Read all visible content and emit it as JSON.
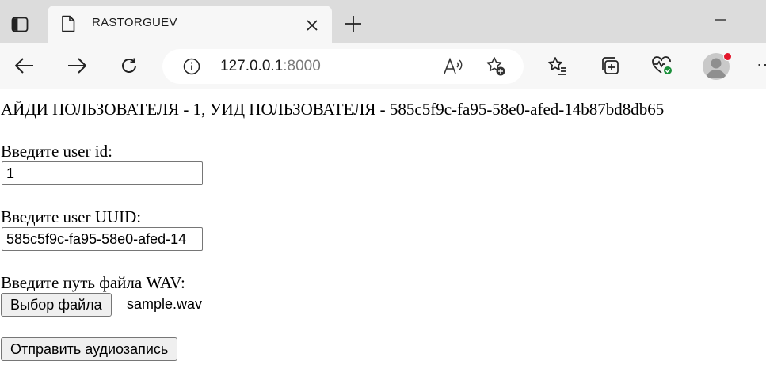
{
  "browser": {
    "tab": {
      "title": "RASTORGUEV"
    },
    "address": {
      "host": "127.0.0.1",
      "port": ":8000"
    }
  },
  "page": {
    "heading": "АЙДИ ПОЛЬЗОВАТЕЛЯ - 1, УИД ПОЛЬЗОВАТЕЛЯ - 585c5f9c-fa95-58e0-afed-14b87bd8db65",
    "user_id": {
      "label": "Введите user id:",
      "value": "1"
    },
    "user_uuid": {
      "label": "Введите user UUID:",
      "value": "585c5f9c-fa95-58e0-afed-14"
    },
    "wav": {
      "label": "Введите путь файла WAV:",
      "button": "Выбор файла",
      "filename": "sample.wav"
    },
    "submit_label": "Отправить аудиозапись"
  },
  "colors": {
    "avatar_badge": "#e3162b",
    "health_badge": "#1a8f3a"
  }
}
